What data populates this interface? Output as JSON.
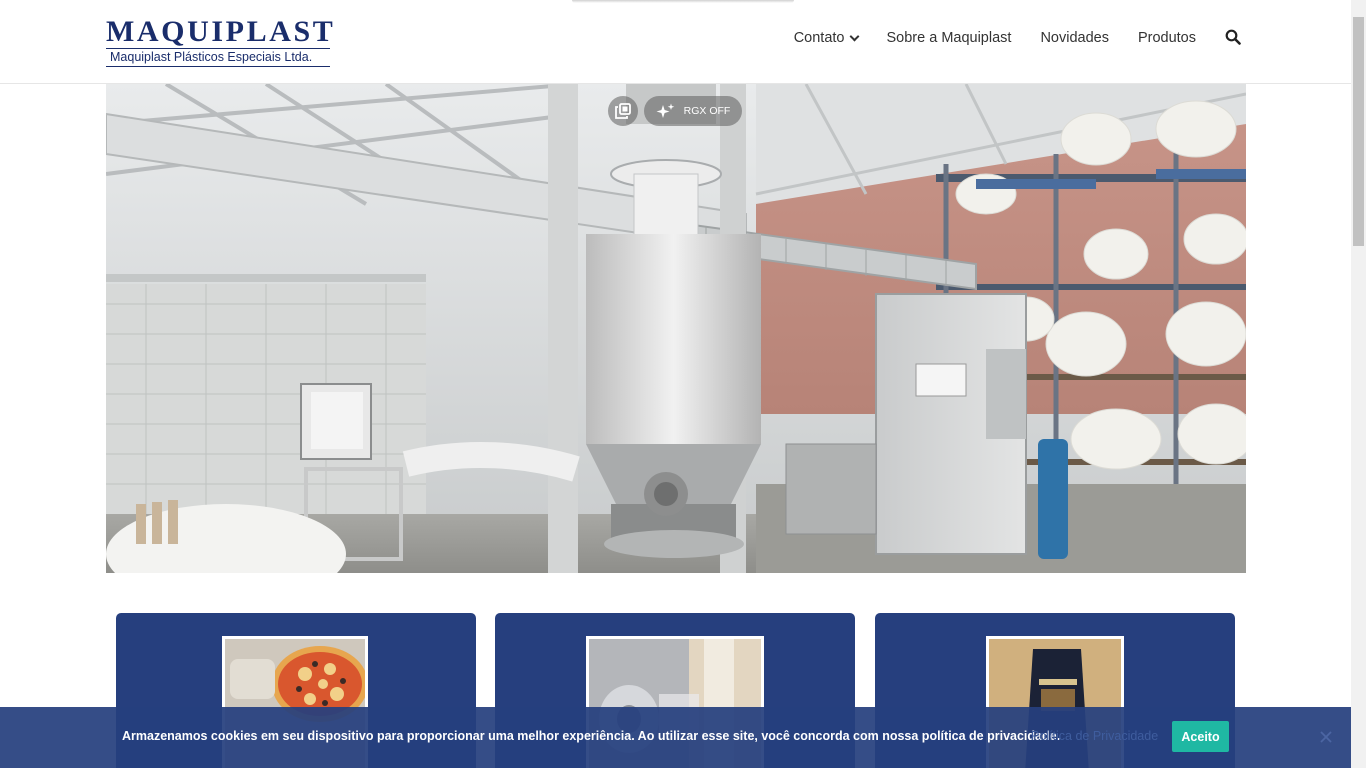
{
  "logo": {
    "main": "MAQUIPLAST",
    "sub": "Maquiplast Plásticos Especiais Ltda."
  },
  "nav": {
    "items": [
      {
        "label": "Contato",
        "has_dropdown": true
      },
      {
        "label": "Sobre a Maquiplast"
      },
      {
        "label": "Novidades"
      },
      {
        "label": "Produtos"
      }
    ],
    "search_icon": "search-icon"
  },
  "hero": {
    "copy_icon": "gallery-copy-icon",
    "rgx_label": "RGX OFF",
    "sparkle_icon": "sparkle-icon"
  },
  "cards": [
    {
      "image": "pizza-product-photo"
    },
    {
      "image": "plastic-film-roll-photo"
    },
    {
      "image": "food-package-photo"
    }
  ],
  "cookie": {
    "text": "Armazenamos cookies em seu dispositivo para proporcionar uma melhor experiência. Ao utilizar esse site, você concorda com nossa política de privacidade.",
    "policy_link": "Política de Privacidade",
    "accept_label": "Aceito",
    "close_icon": "close-icon"
  },
  "colors": {
    "brand_navy": "#1a2d6b",
    "card_blue": "#263f7e",
    "accept_green": "#1fb8a3"
  }
}
